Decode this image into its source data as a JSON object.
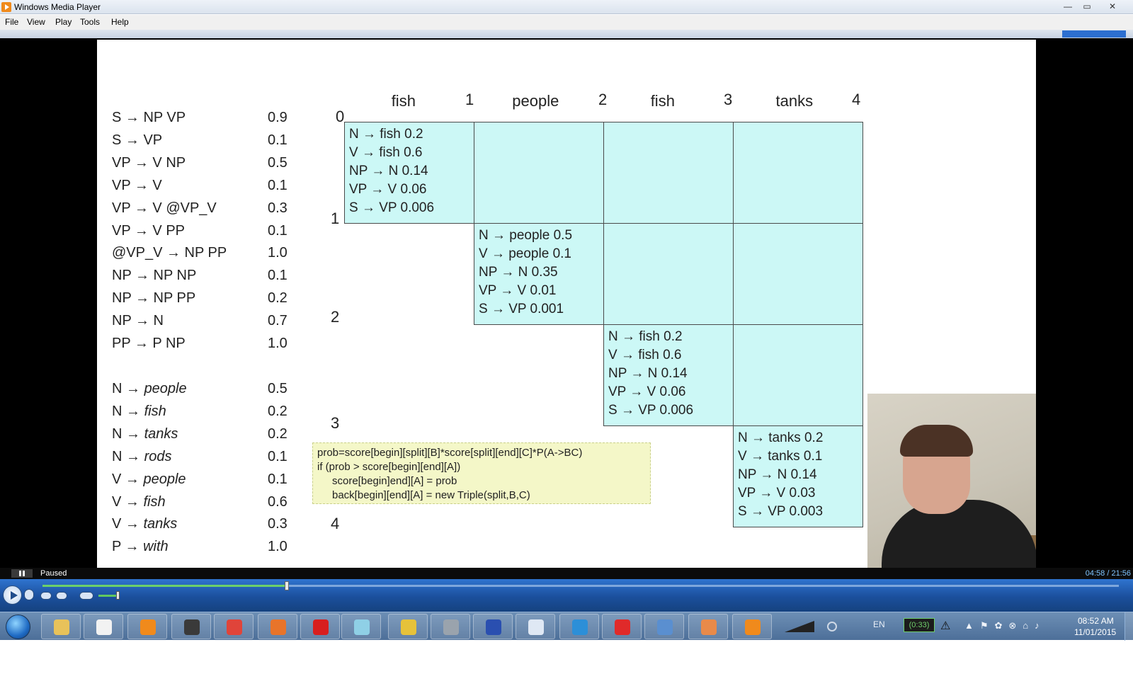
{
  "window": {
    "title": "Windows Media Player",
    "controls": {
      "minimize": "—",
      "maximize": "▭",
      "close": "✕"
    }
  },
  "menu": {
    "file": "File",
    "view": "View",
    "play": "Play",
    "tools": "Tools",
    "help": "Help"
  },
  "slide": {
    "grammar_rules": [
      {
        "rule": "S → NP VP",
        "prob": "0.9"
      },
      {
        "rule": "S → VP",
        "prob": "0.1"
      },
      {
        "rule": "VP → V NP",
        "prob": "0.5"
      },
      {
        "rule": "VP → V",
        "prob": "0.1"
      },
      {
        "rule": "VP → V @VP_V",
        "prob": "0.3"
      },
      {
        "rule": "VP → V PP",
        "prob": "0.1"
      },
      {
        "rule": "@VP_V → NP PP",
        "prob": "1.0"
      },
      {
        "rule": "NP → NP NP",
        "prob": "0.1"
      },
      {
        "rule": "NP → NP PP",
        "prob": "0.2"
      },
      {
        "rule": "NP → N",
        "prob": "0.7"
      },
      {
        "rule": "PP → P NP",
        "prob": "1.0"
      }
    ],
    "lexicon_rules": [
      {
        "lhs": "N →",
        "word": "people",
        "prob": "0.5"
      },
      {
        "lhs": "N →",
        "word": "fish",
        "prob": "0.2"
      },
      {
        "lhs": "N →",
        "word": "tanks",
        "prob": "0.2"
      },
      {
        "lhs": "N →",
        "word": "rods",
        "prob": "0.1"
      },
      {
        "lhs": "V →",
        "word": "people",
        "prob": "0.1"
      },
      {
        "lhs": "V →",
        "word": "fish",
        "prob": "0.6"
      },
      {
        "lhs": "V →",
        "word": "tanks",
        "prob": "0.3"
      },
      {
        "lhs": "P →",
        "word": "with",
        "prob": "1.0"
      }
    ],
    "words": [
      "fish",
      "people",
      "fish",
      "tanks"
    ],
    "indices": [
      "0",
      "1",
      "2",
      "3",
      "4"
    ],
    "cells": [
      [
        "N → fish 0.2",
        "V → fish 0.6",
        "NP → N 0.14",
        "VP → V 0.06",
        "S → VP 0.006"
      ],
      [
        "N → people 0.5",
        "V → people 0.1",
        "NP → N 0.35",
        "VP → V 0.01",
        "S → VP 0.001"
      ],
      [
        "N → fish 0.2",
        "V → fish 0.6",
        "NP → N 0.14",
        "VP → V 0.06",
        "S → VP 0.006"
      ],
      [
        "N → tanks 0.2",
        "V → tanks 0.1",
        "NP → N 0.14",
        "VP → V 0.03",
        "S → VP 0.003"
      ]
    ],
    "code": [
      "prob=score[begin][split][B]*score[split][end][C]*P(A->BC)",
      "if (prob > score[begin][end][A])",
      "score[begin]end][A] = prob",
      "back[begin][end][A] = new Triple(split,B,C)"
    ]
  },
  "player": {
    "status": "Paused",
    "time": "04:58 / 21:56",
    "progress_fraction": 0.227
  },
  "taskbar": {
    "language": "EN",
    "battery": "(0:33)",
    "clock_time": "08:52 AM",
    "clock_date": "11/01/2015",
    "apps": [
      {
        "name": "explorer-icon",
        "color": "#e8c25a"
      },
      {
        "name": "notepad-icon",
        "color": "#f2f2f2"
      },
      {
        "name": "media-player-icon",
        "color": "#f08a1c"
      },
      {
        "name": "speaker-app-icon",
        "color": "#3a3a3a"
      },
      {
        "name": "chrome-icon",
        "color": "#e0443a"
      },
      {
        "name": "firefox-icon",
        "color": "#e8742a"
      },
      {
        "name": "opera-icon",
        "color": "#d81e1e"
      },
      {
        "name": "editor-icon",
        "color": "#8fd0e6"
      },
      {
        "name": "puzzle-app-icon",
        "color": "#e6c23a"
      },
      {
        "name": "archive-icon",
        "color": "#9aa3ad"
      },
      {
        "name": "calculator-grid-icon",
        "color": "#2a4fb0"
      },
      {
        "name": "calculator-icon",
        "color": "#dfe8f4"
      },
      {
        "name": "people-app-icon",
        "color": "#2c8fd8"
      },
      {
        "name": "red-app-icon",
        "color": "#e02a2a"
      },
      {
        "name": "photo-viewer-icon",
        "color": "#5a8fd0"
      },
      {
        "name": "paint-icon",
        "color": "#e88a4a"
      },
      {
        "name": "blender-icon",
        "color": "#f08a1c"
      }
    ]
  }
}
